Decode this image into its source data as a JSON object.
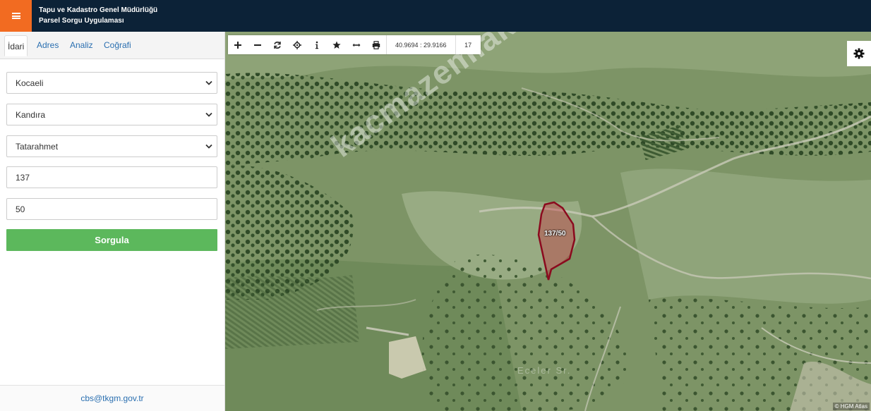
{
  "header": {
    "title_line1": "Tapu ve Kadastro Genel Müdürlüğü",
    "title_line2": "Parsel Sorgu Uygulaması",
    "menu_icon": "hamburger-icon",
    "accent_color": "#f26b21",
    "bar_color": "#0c2237"
  },
  "sidebar": {
    "tabs": [
      {
        "label": "İdari",
        "active": true
      },
      {
        "label": "Adres",
        "active": false
      },
      {
        "label": "Analiz",
        "active": false
      },
      {
        "label": "Coğrafi",
        "active": false
      }
    ],
    "province": "Kocaeli",
    "district": "Kandıra",
    "neighborhood": "Tatarahmet",
    "block": "137",
    "parcel": "50",
    "submit_label": "Sorgula",
    "submit_color": "#5cb85c",
    "footer_email": "cbs@tkgm.gov.tr"
  },
  "map": {
    "toolbar": {
      "icons": [
        "zoom-in-icon",
        "zoom-out-icon",
        "refresh-icon",
        "locate-icon",
        "info-icon",
        "star-icon",
        "measure-icon",
        "print-icon"
      ],
      "coordinates": "40.9694 : 29.9166",
      "zoom": "17"
    },
    "settings_icon": "gear-icon",
    "parcel_label": "137/50",
    "parcel_outline_color": "#8b0a1e",
    "watermark": "kacmazemlak.com",
    "place_label": "Eceler Sr.",
    "attribution": "© HGM Atlas"
  }
}
